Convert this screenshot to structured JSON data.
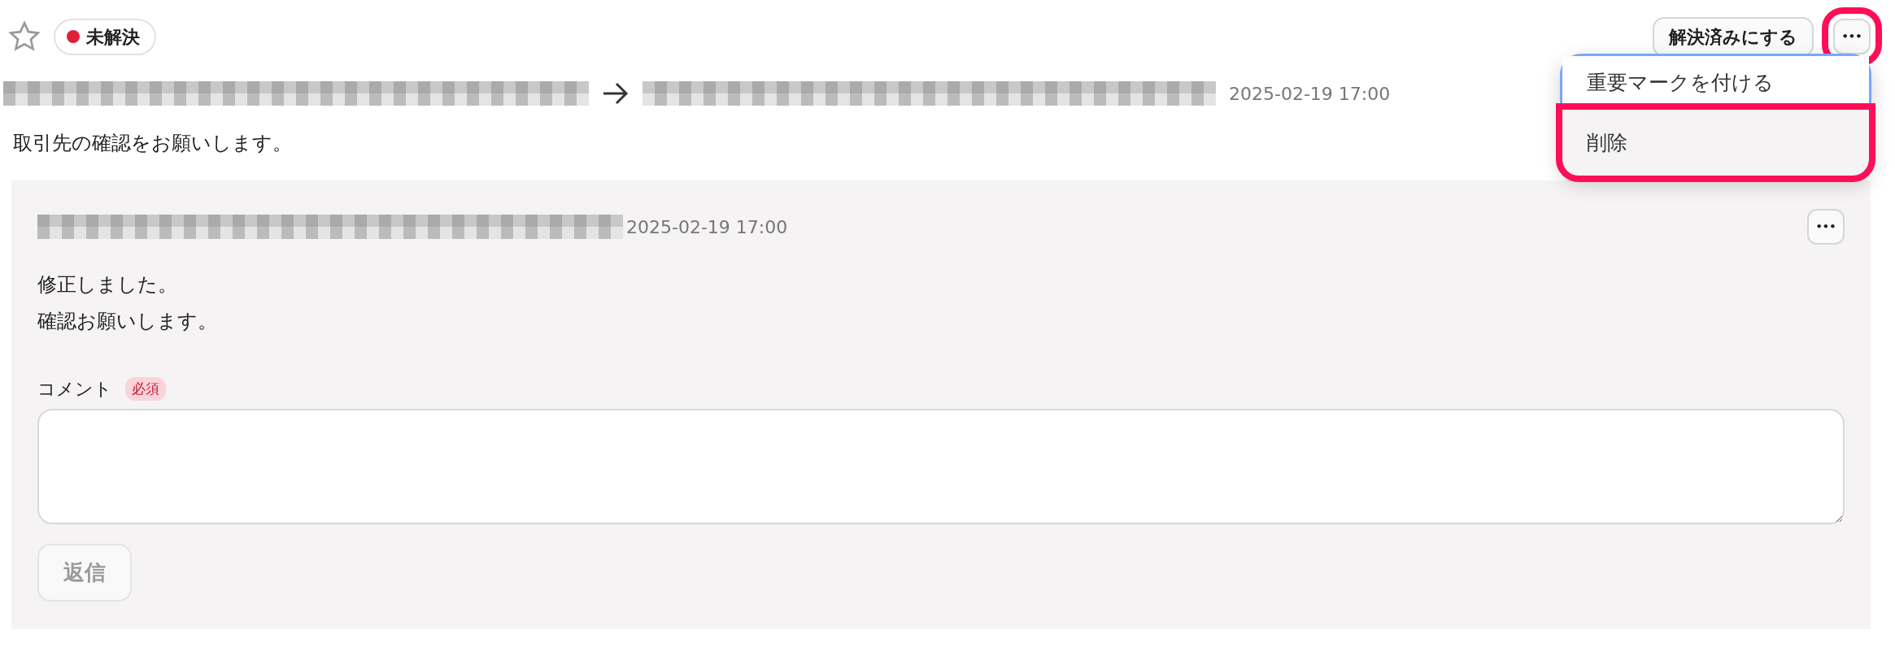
{
  "header": {
    "starred": false,
    "status": {
      "label": "未解決",
      "color": "#e0203a"
    },
    "resolve_button": "解決済みにする",
    "more_button": {
      "label": "•••",
      "highlighted": true
    }
  },
  "menu": {
    "items": [
      {
        "label": "重要マークを付ける",
        "highlighted": false
      },
      {
        "label": "削除",
        "highlighted": true
      }
    ]
  },
  "thread": {
    "timestamp": "2025-02-19 17:00",
    "message": "取引先の確認をお願いします。"
  },
  "reply": {
    "timestamp": "2025-02-19 17:00",
    "more_button": "•••",
    "lines": [
      "修正しました。",
      "確認お願いします。"
    ]
  },
  "comment": {
    "label": "コメント",
    "required_badge": "必須"
  },
  "submit": {
    "label": "返信",
    "disabled": true
  }
}
